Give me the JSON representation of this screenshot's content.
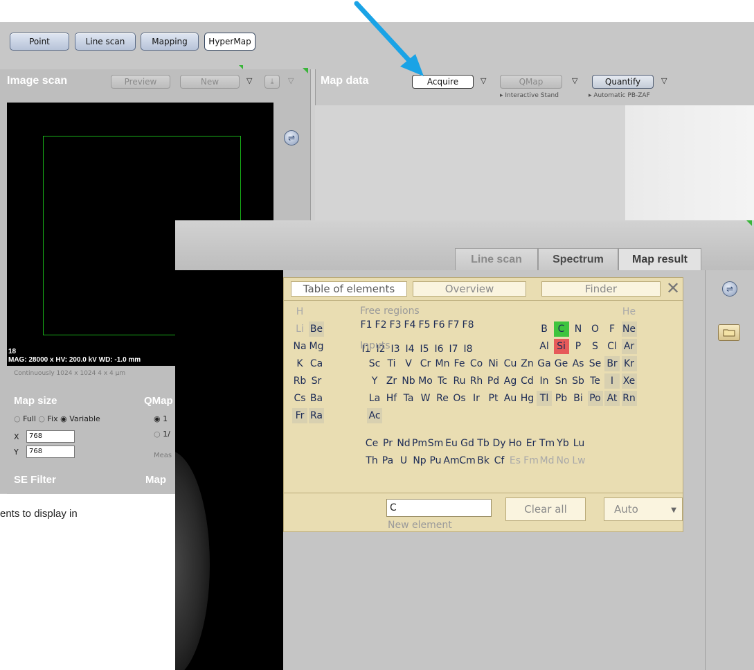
{
  "modes": {
    "point": "Point",
    "line_scan": "Line scan",
    "mapping": "Mapping",
    "hypermap": "HyperMap"
  },
  "image_scan": {
    "title": "Image scan",
    "preview": "Preview",
    "new": "New",
    "frame_number": "18",
    "info": "MAG: 28000 x HV: 200.0 kV WD: -1.0 mm",
    "status": "Continuously  1024 x 1024  4 x 4 µm"
  },
  "map_data": {
    "title": "Map data",
    "acquire": "Acquire",
    "qmap": "QMap",
    "quantify": "Quantify",
    "interactive_stand": "Interactive Stand",
    "automatic_pbzaf": "Automatic PB-ZAF"
  },
  "settings": {
    "map_size_title": "Map size",
    "qmap_title": "QMap",
    "full": "Full",
    "fix": "Fix",
    "variable": "Variable",
    "opt_1": "1",
    "opt_2": "1/",
    "meas": "Meas",
    "x_label": "X",
    "y_label": "Y",
    "x_value": "768",
    "y_value": "768",
    "se_filter_title": "SE Filter",
    "map_title": "Map"
  },
  "caption": "ents to display in",
  "result_tabs": {
    "line_scan": "Line scan",
    "spectrum": "Spectrum",
    "map_result": "Map result"
  },
  "pte": {
    "tab_table": "Table of elements",
    "tab_overview": "Overview",
    "tab_finder": "Finder",
    "close": "✕",
    "free_regions": "Free regions",
    "inputs": "Inputs",
    "new_element_value": "C",
    "new_element_label": "New element",
    "clear_all": "Clear all",
    "auto": "Auto",
    "rows": [
      [
        {
          "s": "H",
          "c": 1,
          "st": "dim"
        },
        {
          "s": "He",
          "c": 18,
          "st": "dim"
        }
      ],
      [
        {
          "s": "Li",
          "c": 1,
          "st": "dim"
        },
        {
          "s": "Be",
          "c": 2,
          "st": "sh"
        },
        {
          "s": "B",
          "c": 13
        },
        {
          "s": "C",
          "c": 14,
          "st": "grn"
        },
        {
          "s": "N",
          "c": 15
        },
        {
          "s": "O",
          "c": 16
        },
        {
          "s": "F",
          "c": 17
        },
        {
          "s": "Ne",
          "c": 18,
          "st": "sh"
        }
      ],
      [
        {
          "s": "Na",
          "c": 1
        },
        {
          "s": "Mg",
          "c": 2
        },
        {
          "s": "Al",
          "c": 13
        },
        {
          "s": "Si",
          "c": 14,
          "st": "red"
        },
        {
          "s": "P",
          "c": 15
        },
        {
          "s": "S",
          "c": 16
        },
        {
          "s": "Cl",
          "c": 17
        },
        {
          "s": "Ar",
          "c": 18,
          "st": "sh"
        }
      ],
      [
        {
          "s": "K",
          "c": 1
        },
        {
          "s": "Ca",
          "c": 2
        },
        {
          "s": "Sc",
          "c": 3
        },
        {
          "s": "Ti",
          "c": 4
        },
        {
          "s": "V",
          "c": 5
        },
        {
          "s": "Cr",
          "c": 6
        },
        {
          "s": "Mn",
          "c": 7
        },
        {
          "s": "Fe",
          "c": 8
        },
        {
          "s": "Co",
          "c": 9
        },
        {
          "s": "Ni",
          "c": 10
        },
        {
          "s": "Cu",
          "c": 11
        },
        {
          "s": "Zn",
          "c": 12
        },
        {
          "s": "Ga",
          "c": 13
        },
        {
          "s": "Ge",
          "c": 14
        },
        {
          "s": "As",
          "c": 15
        },
        {
          "s": "Se",
          "c": 16
        },
        {
          "s": "Br",
          "c": 17,
          "st": "sh"
        },
        {
          "s": "Kr",
          "c": 18,
          "st": "sh"
        }
      ],
      [
        {
          "s": "Rb",
          "c": 1
        },
        {
          "s": "Sr",
          "c": 2
        },
        {
          "s": "Y",
          "c": 3
        },
        {
          "s": "Zr",
          "c": 4
        },
        {
          "s": "Nb",
          "c": 5
        },
        {
          "s": "Mo",
          "c": 6
        },
        {
          "s": "Tc",
          "c": 7
        },
        {
          "s": "Ru",
          "c": 8
        },
        {
          "s": "Rh",
          "c": 9
        },
        {
          "s": "Pd",
          "c": 10
        },
        {
          "s": "Ag",
          "c": 11
        },
        {
          "s": "Cd",
          "c": 12
        },
        {
          "s": "In",
          "c": 13
        },
        {
          "s": "Sn",
          "c": 14
        },
        {
          "s": "Sb",
          "c": 15
        },
        {
          "s": "Te",
          "c": 16
        },
        {
          "s": "I",
          "c": 17,
          "st": "sh"
        },
        {
          "s": "Xe",
          "c": 18,
          "st": "sh"
        }
      ],
      [
        {
          "s": "Cs",
          "c": 1
        },
        {
          "s": "Ba",
          "c": 2
        },
        {
          "s": "La",
          "c": 3
        },
        {
          "s": "Hf",
          "c": 4
        },
        {
          "s": "Ta",
          "c": 5
        },
        {
          "s": "W",
          "c": 6
        },
        {
          "s": "Re",
          "c": 7
        },
        {
          "s": "Os",
          "c": 8
        },
        {
          "s": "Ir",
          "c": 9
        },
        {
          "s": "Pt",
          "c": 10
        },
        {
          "s": "Au",
          "c": 11
        },
        {
          "s": "Hg",
          "c": 12
        },
        {
          "s": "Tl",
          "c": 13,
          "st": "sh"
        },
        {
          "s": "Pb",
          "c": 14
        },
        {
          "s": "Bi",
          "c": 15
        },
        {
          "s": "Po",
          "c": 16,
          "st": "sh"
        },
        {
          "s": "At",
          "c": 17,
          "st": "sh"
        },
        {
          "s": "Rn",
          "c": 18,
          "st": "sh"
        }
      ],
      [
        {
          "s": "Fr",
          "c": 1,
          "st": "sh"
        },
        {
          "s": "Ra",
          "c": 2,
          "st": "sh"
        },
        {
          "s": "Ac",
          "c": 3,
          "st": "sh"
        }
      ]
    ],
    "f_rows": [
      [
        {
          "s": "Ce"
        },
        {
          "s": "Pr"
        },
        {
          "s": "Nd"
        },
        {
          "s": "Pm"
        },
        {
          "s": "Sm"
        },
        {
          "s": "Eu"
        },
        {
          "s": "Gd"
        },
        {
          "s": "Tb"
        },
        {
          "s": "Dy"
        },
        {
          "s": "Ho"
        },
        {
          "s": "Er"
        },
        {
          "s": "Tm"
        },
        {
          "s": "Yb"
        },
        {
          "s": "Lu"
        }
      ],
      [
        {
          "s": "Th"
        },
        {
          "s": "Pa"
        },
        {
          "s": "U"
        },
        {
          "s": "Np"
        },
        {
          "s": "Pu"
        },
        {
          "s": "Am"
        },
        {
          "s": "Cm"
        },
        {
          "s": "Bk"
        },
        {
          "s": "Cf"
        },
        {
          "s": "Es",
          "st": "dim"
        },
        {
          "s": "Fm",
          "st": "dim"
        },
        {
          "s": "Md",
          "st": "dim"
        },
        {
          "s": "No",
          "st": "dim"
        },
        {
          "s": "Lw",
          "st": "dim"
        }
      ]
    ],
    "free_region_labels": [
      "F1",
      "F2",
      "F3",
      "F4",
      "F5",
      "F6",
      "F7",
      "F8"
    ],
    "input_labels": [
      "I1",
      "I2",
      "I3",
      "I4",
      "I5",
      "I6",
      "I7",
      "I8"
    ]
  },
  "annotation": {
    "arrow_color": "#1aa3e6"
  }
}
